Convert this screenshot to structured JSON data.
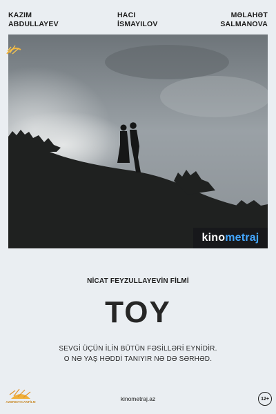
{
  "cast": [
    {
      "name": "KAZIM\nABDULLAYEV"
    },
    {
      "name": "HACI\nİSMAYILOV"
    },
    {
      "name": "MƏLAHƏT\nSALMANOVA"
    }
  ],
  "badge": {
    "part1": "kino",
    "part2": "metraj",
    "part2_color": "#44a7ff"
  },
  "director": "NİCAT FEYZULLAYEVİN FİLMİ",
  "title": "TOY",
  "tagline": [
    "SEVGİ ÜÇÜN İLİN BÜTÜN FƏSİLLƏRİ EYNİDİR.",
    "O NƏ YAŞ HƏDDİ TANIYIR NƏ DƏ SƏRHƏD."
  ],
  "studio": {
    "text": "AZƏRBAYCANFİLM",
    "color": "#c88a2a"
  },
  "website": "kinometraj.az",
  "age_rating": "12+"
}
